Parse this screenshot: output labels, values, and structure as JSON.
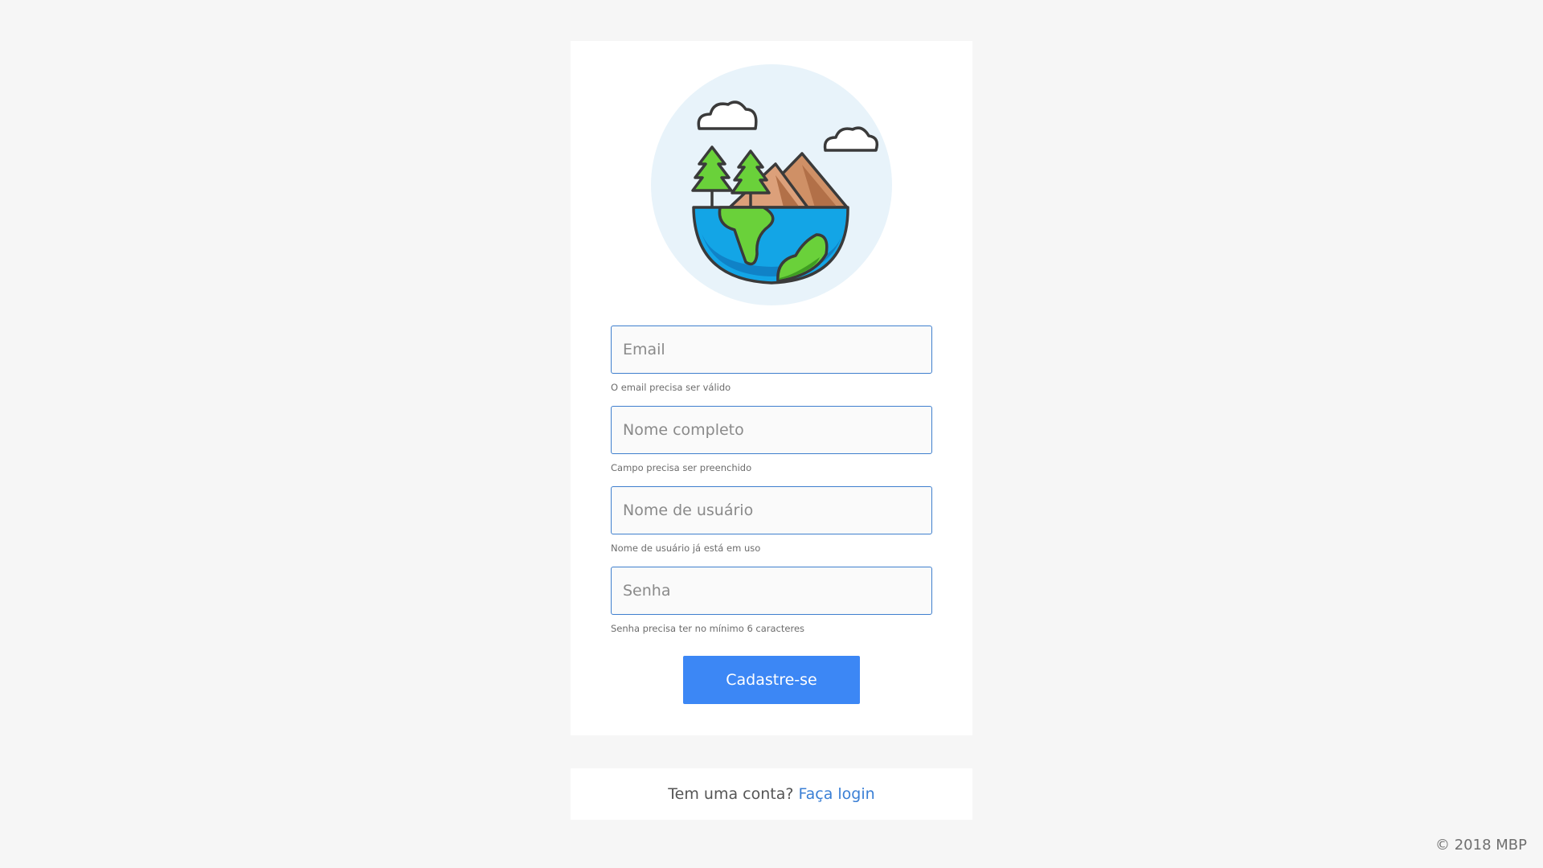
{
  "logo": {
    "name": "earth-landscape-icon"
  },
  "form": {
    "email": {
      "placeholder": "Email",
      "value": "",
      "hint": "O email precisa ser válido"
    },
    "fullname": {
      "placeholder": "Nome completo",
      "value": "",
      "hint": "Campo precisa ser preenchido"
    },
    "username": {
      "placeholder": "Nome de usuário",
      "value": "",
      "hint": "Nome de usuário já está em uso"
    },
    "password": {
      "placeholder": "Senha",
      "value": "",
      "hint": "Senha precisa ter no mínimo 6 caracteres"
    },
    "submit_label": "Cadastre-se"
  },
  "login": {
    "prompt": "Tem uma conta?",
    "link_label": "Faça login"
  },
  "footer": {
    "copyright": "© 2018 MBP"
  },
  "colors": {
    "accent": "#3c87f5",
    "link": "#3a7fd5",
    "input_border": "#3f7fce",
    "background": "#f6f6f6"
  }
}
